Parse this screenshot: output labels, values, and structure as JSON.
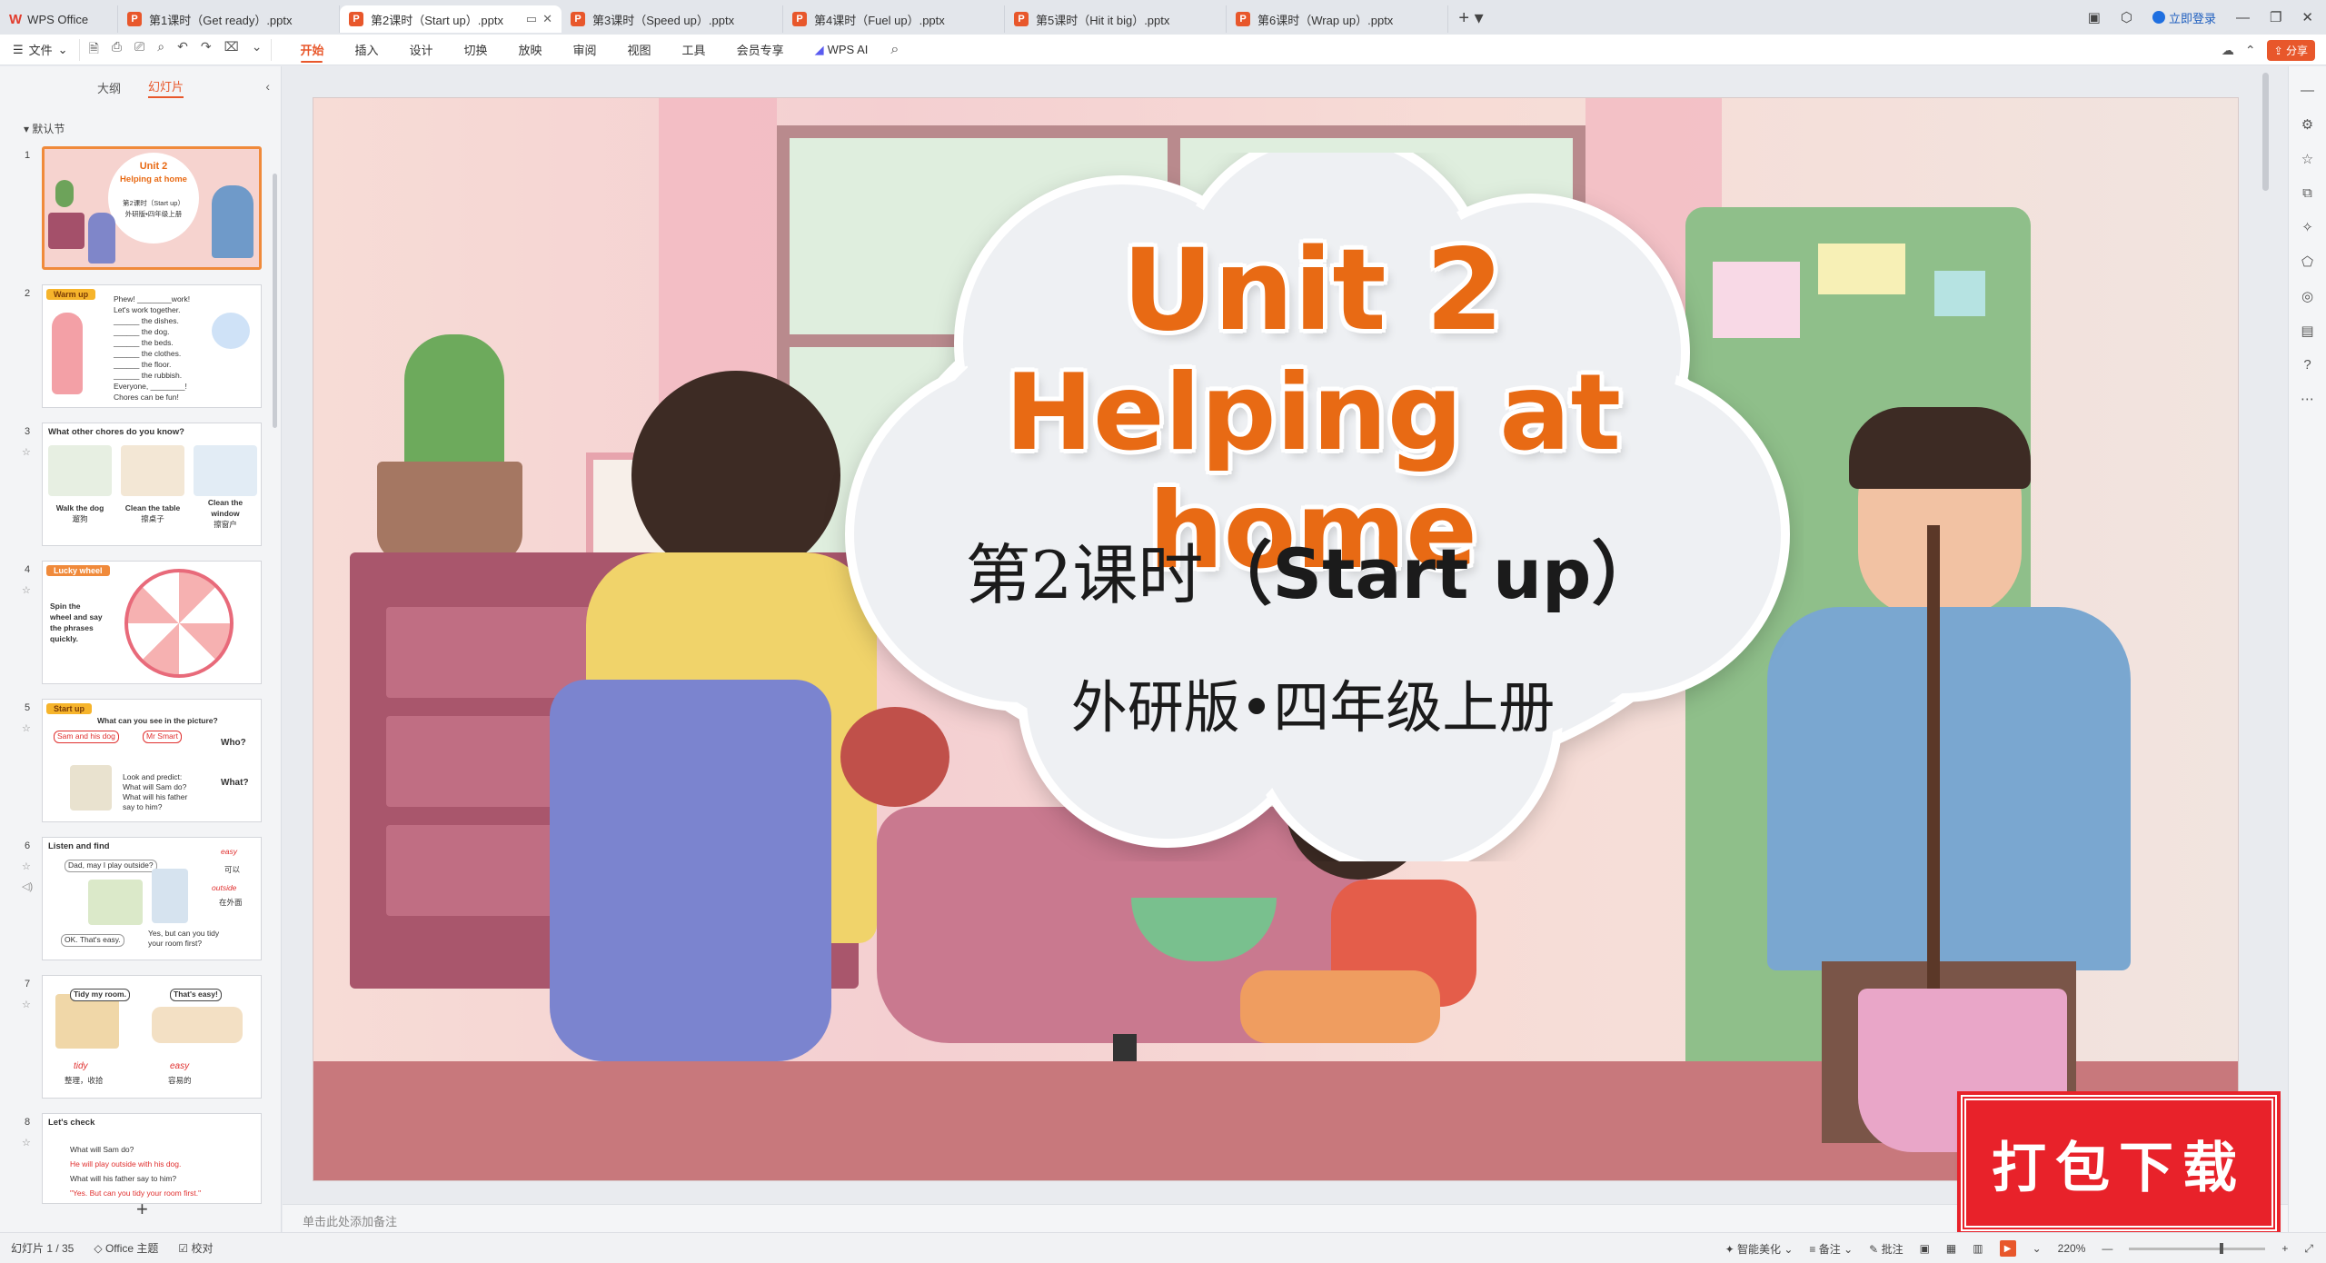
{
  "tabs": [
    {
      "label": "WPS Office",
      "kind": "home"
    },
    {
      "label": "第1课时（Get ready）.pptx",
      "kind": "ppt"
    },
    {
      "label": "第2课时（Start up）.pptx",
      "kind": "ppt",
      "active": true
    },
    {
      "label": "第3课时（Speed up）.pptx",
      "kind": "ppt"
    },
    {
      "label": "第4课时（Fuel up）.pptx",
      "kind": "ppt"
    },
    {
      "label": "第5课时（Hit it big）.pptx",
      "kind": "ppt"
    },
    {
      "label": "第6课时（Wrap up）.pptx",
      "kind": "ppt"
    }
  ],
  "window": {
    "login_label": "立即登录"
  },
  "ribbon": {
    "file_label": "文件",
    "menu": [
      "开始",
      "插入",
      "设计",
      "切换",
      "放映",
      "审阅",
      "视图",
      "工具",
      "会员专享",
      "WPS AI"
    ],
    "active_menu": "开始",
    "share_label": "分享"
  },
  "left_panel": {
    "tabs": [
      "大纲",
      "幻灯片"
    ],
    "active_tab": "幻灯片",
    "section_label": "默认节",
    "slides": [
      {
        "num": "1",
        "title": "Unit 2",
        "subtitle": "Helping at home",
        "line1": "第2课时（Start up）",
        "line2": "外研版•四年级上册"
      },
      {
        "num": "2",
        "tag": "Warm up",
        "lines": [
          "Phew! ________work!",
          "Let's work together.",
          "______ the dishes.",
          "______ the dog.",
          "______ the beds.",
          "______ the clothes.",
          "______ the floor.",
          "______ the rubbish.",
          "Everyone, ________!",
          "Chores can be fun!"
        ]
      },
      {
        "num": "3",
        "title": "What other chores do you know?",
        "captions": [
          "Walk the dog",
          "Clean the table",
          "Clean the window"
        ],
        "captions_cn": [
          "遛狗",
          "擦桌子",
          "擦窗户"
        ]
      },
      {
        "num": "4",
        "tag": "Lucky wheel",
        "lines": [
          "Spin the",
          "wheel and say",
          "the phrases",
          "quickly."
        ]
      },
      {
        "num": "5",
        "tag": "Start up",
        "question": "What can you see in the picture?",
        "labels": [
          "Sam and his dog",
          "Mr Smart",
          "Who?",
          "What?"
        ],
        "lines": [
          "Look and predict:",
          "What will Sam do?",
          "What will his father",
          "say to him?"
        ]
      },
      {
        "num": "6",
        "title": "Listen and find",
        "lines": [
          "Dad, may I play outside?",
          "OK. That's easy.",
          "Yes, but can you tidy",
          "your room first?"
        ],
        "notes": [
          "easy",
          "outside",
          "可以",
          "在外面"
        ]
      },
      {
        "num": "7",
        "bubbles": [
          "Tidy my room.",
          "That's easy!"
        ],
        "words": [
          "tidy",
          "easy"
        ],
        "words_cn": [
          "整理，收拾",
          "容易的"
        ]
      },
      {
        "num": "8",
        "title": "Let's check",
        "lines": [
          "What will Sam do?",
          "He will play outside with his dog.",
          "What will his father say to him?",
          "\"Yes. But can you tidy your room first.\""
        ]
      }
    ]
  },
  "slide": {
    "title_line1": "Unit 2",
    "title_line2": "Helping at home",
    "lesson_cn": "第2课时",
    "lesson_en": "（Start up）",
    "publisher": "外研版•四年级上册"
  },
  "notes_placeholder": "单击此处添加备注",
  "watermark": "打包下载",
  "status": {
    "slide_counter": "幻灯片 1 / 35",
    "theme": "Office 主题",
    "proof": "校对",
    "beautify": "智能美化",
    "notes": "备注",
    "comments": "批注",
    "zoom": "220%"
  },
  "colors": {
    "accent": "#e8572b",
    "title_orange": "#e86a14",
    "watermark_red": "#e8222a"
  }
}
